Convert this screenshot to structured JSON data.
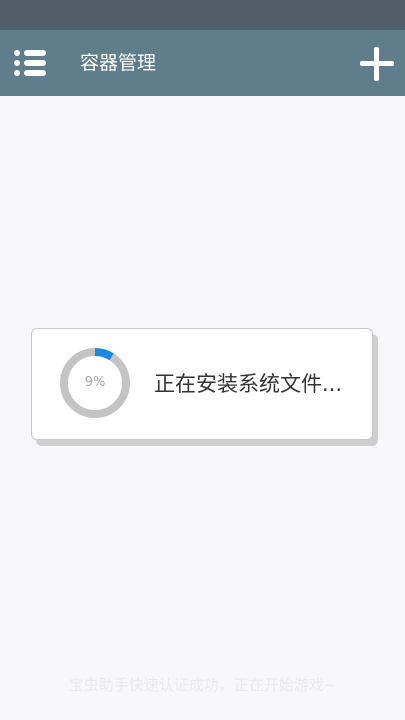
{
  "app_bar": {
    "menu_icon": "list-menu-icon",
    "title": "容器管理",
    "add_icon": "plus-icon"
  },
  "loading_dialog": {
    "progress_percent": 9,
    "progress_label": "9%",
    "message": "正在安装系统文件...",
    "colors": {
      "track": "#c4c4c4",
      "progress": "#1e88e5"
    }
  },
  "toast": {
    "message": "宝虫助手快速认证成功，正在开始游戏~"
  },
  "colors": {
    "status_bar": "#4e5d67",
    "app_bar": "#607d8b",
    "background": "#f8f7fa"
  }
}
